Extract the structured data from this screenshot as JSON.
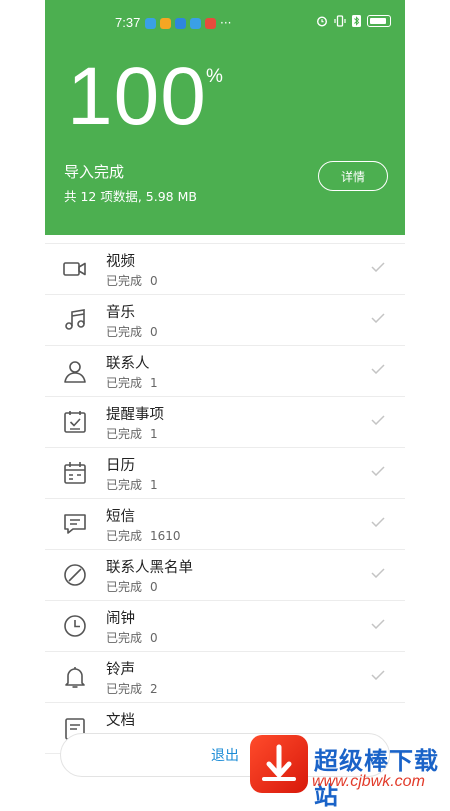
{
  "status_bar": {
    "time": "7:37",
    "notif_colors": [
      "#3aa0e6",
      "#f5a623",
      "#2e86de",
      "#3aa0e6",
      "#e74c3c"
    ],
    "right_icons": [
      "alarm-icon",
      "vibrate-icon",
      "bluetooth-icon",
      "battery-icon"
    ],
    "more": "···"
  },
  "header": {
    "percent": "100",
    "percent_symbol": "%",
    "title": "导入完成",
    "summary": "共 12 项数据, 5.98 MB",
    "detail_label": "详情"
  },
  "items": [
    {
      "name": "视频",
      "status": "已完成",
      "count": "0",
      "icon": "video-icon"
    },
    {
      "name": "音乐",
      "status": "已完成",
      "count": "0",
      "icon": "music-icon"
    },
    {
      "name": "联系人",
      "status": "已完成",
      "count": "1",
      "icon": "contact-icon"
    },
    {
      "name": "提醒事项",
      "status": "已完成",
      "count": "1",
      "icon": "reminder-icon"
    },
    {
      "name": "日历",
      "status": "已完成",
      "count": "1",
      "icon": "calendar-icon"
    },
    {
      "name": "短信",
      "status": "已完成",
      "count": "1610",
      "icon": "message-icon"
    },
    {
      "name": "联系人黑名单",
      "status": "已完成",
      "count": "0",
      "icon": "blocklist-icon"
    },
    {
      "name": "闹钟",
      "status": "已完成",
      "count": "0",
      "icon": "clock-icon"
    },
    {
      "name": "铃声",
      "status": "已完成",
      "count": "2",
      "icon": "bell-icon"
    },
    {
      "name": "文档",
      "status": "",
      "count": "",
      "icon": "document-icon"
    }
  ],
  "exit_label": "退出",
  "watermark": {
    "text": "超级棒下载站",
    "url": "www.cjbwk.com"
  },
  "colors": {
    "accent": "#4CAF50",
    "link": "#1a8bd6"
  }
}
